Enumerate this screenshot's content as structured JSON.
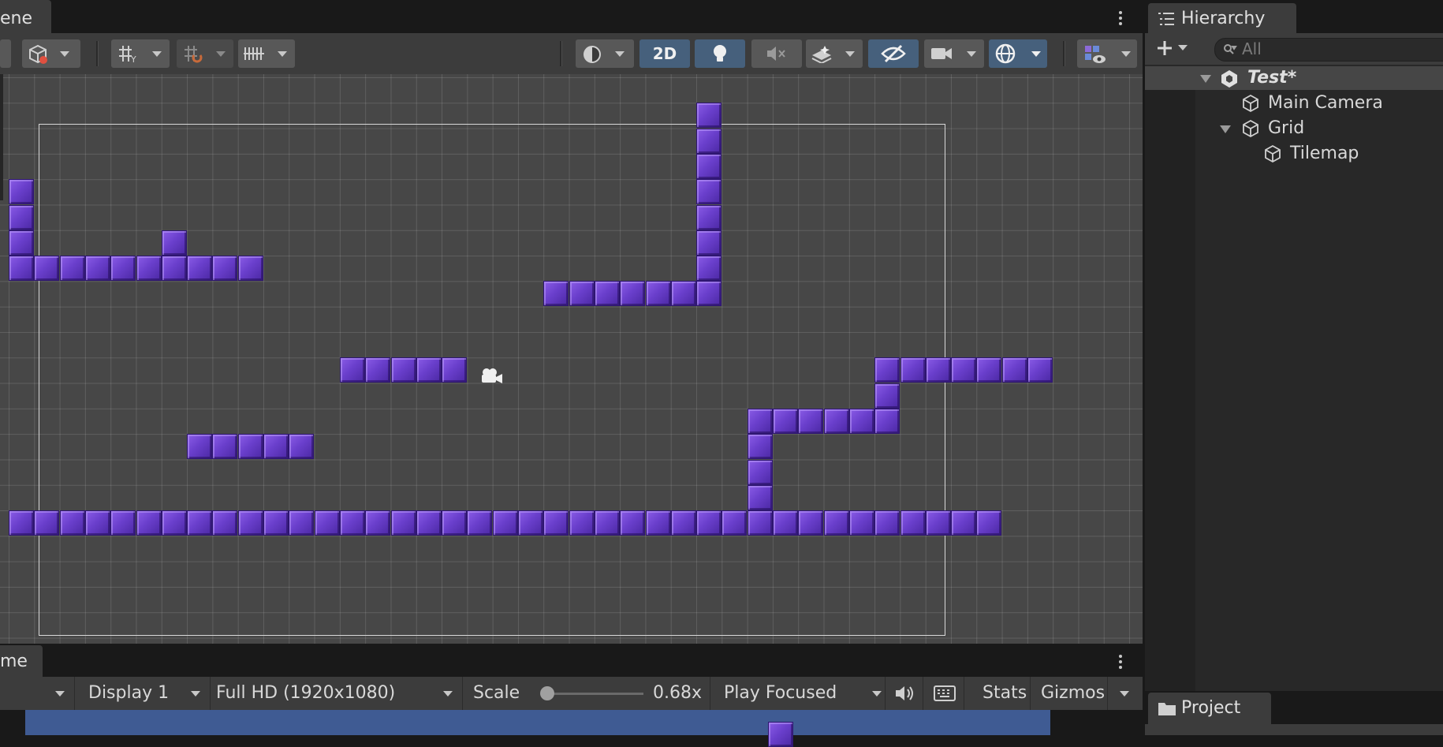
{
  "scene": {
    "tab_label": "ene",
    "toolbar": {
      "btn_2d": "2D",
      "icons": [
        "cube-icon",
        "grid-snap-icon",
        "increment-snap-icon",
        "ruler-icon",
        "shading-icon",
        "light-icon",
        "audio-mute-icon",
        "effects-icon",
        "hidden-visibility-icon",
        "camera-icon",
        "gizmo-globe-icon",
        "gizmos-icon"
      ]
    },
    "tile_color": "#6a3fcc",
    "grid_color": "#474747"
  },
  "game": {
    "tab_label": "me",
    "display": "Display 1",
    "resolution": "Full HD (1920x1080)",
    "scale_label": "Scale",
    "scale_value": "0.68x",
    "scale_fraction": 0.05,
    "play_mode": "Play Focused",
    "stats": "Stats",
    "gizmos": "Gizmos",
    "background_color": "#3f5b93"
  },
  "hierarchy": {
    "tab_label": "Hierarchy",
    "search_placeholder": "All",
    "scene_name": "Test*",
    "items": [
      {
        "label": "Main Camera"
      },
      {
        "label": "Grid"
      },
      {
        "label": "Tilemap"
      }
    ]
  },
  "project": {
    "tab_label": "Project"
  }
}
